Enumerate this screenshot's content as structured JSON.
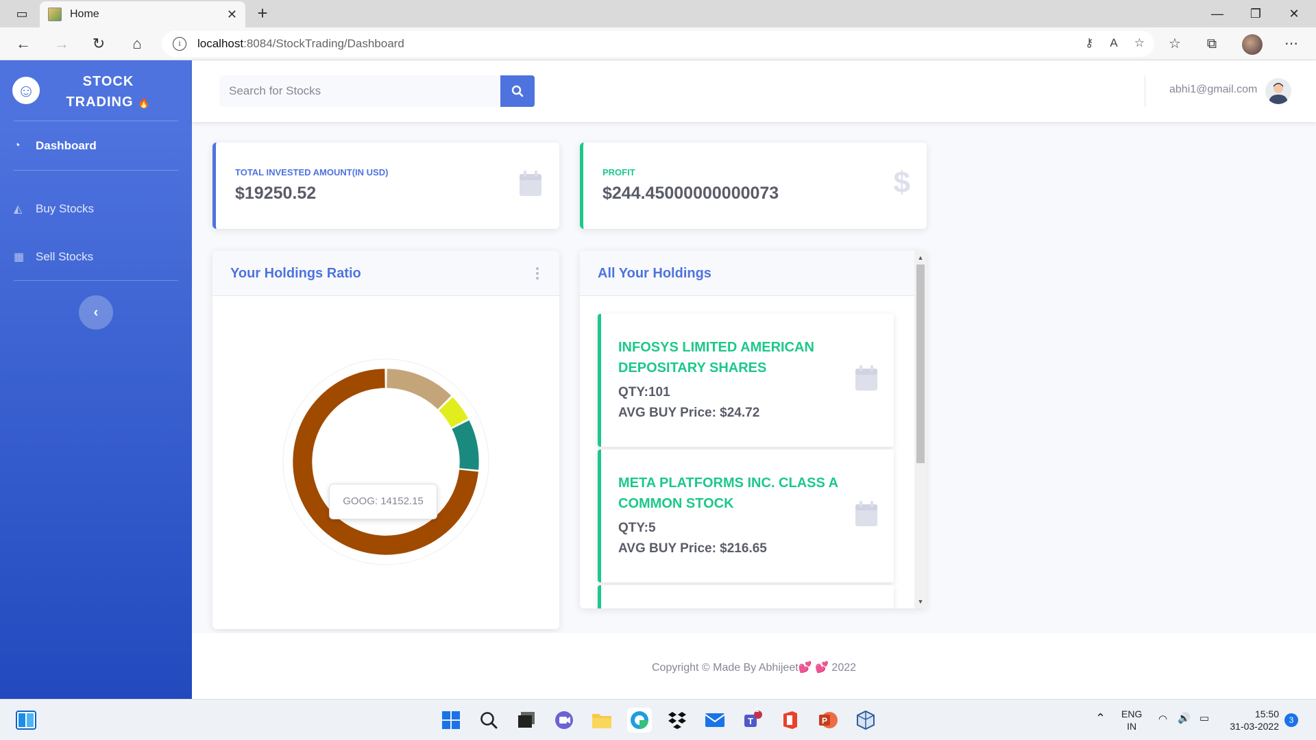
{
  "browser": {
    "tab_title": "Home",
    "url_host": "localhost",
    "url_path": ":8084/StockTrading/Dashboard"
  },
  "sidebar": {
    "brand_line1": "STOCK",
    "brand_line2": "TRADING",
    "items": [
      {
        "label": "Dashboard",
        "icon": "tachometer-icon",
        "active": true
      },
      {
        "label": "Buy Stocks",
        "icon": "area-chart-icon",
        "active": false
      },
      {
        "label": "Sell Stocks",
        "icon": "table-icon",
        "active": false
      }
    ]
  },
  "topbar": {
    "search_placeholder": "Search for Stocks",
    "user_email": "abhi1@gmail.com"
  },
  "stats": {
    "invested_label": "TOTAL INVESTED AMOUNT(IN USD)",
    "invested_value": "$19250.52",
    "profit_label": "PROFIT",
    "profit_value": "$244.45000000000073"
  },
  "holdings_ratio": {
    "title": "Your Holdings Ratio",
    "tooltip": "GOOG: 14152.15"
  },
  "all_holdings": {
    "title": "All Your Holdings",
    "items": [
      {
        "name": "INFOSYS LIMITED AMERICAN DEPOSITARY SHARES",
        "qty": "QTY:101",
        "avg": "AVG BUY Price: $24.72"
      },
      {
        "name": "META PLATFORMS INC. CLASS A COMMON STOCK",
        "qty": "QTY:5",
        "avg": "AVG BUY Price: $216.65"
      }
    ]
  },
  "footer": {
    "copyright": "Copyright © Made By Abhijeet",
    "hearts": "💕 💕",
    "year": "2022"
  },
  "taskbar": {
    "lang1": "ENG",
    "lang2": "IN",
    "time": "15:50",
    "date": "31-03-2022",
    "notifications": "3",
    "teams_badge": "1"
  },
  "colors": {
    "primary": "#4e73df",
    "success": "#1cc88a",
    "donut": [
      "#a04a00",
      "#c4a57a",
      "#e2ed1f",
      "#1b8a7e"
    ]
  }
}
